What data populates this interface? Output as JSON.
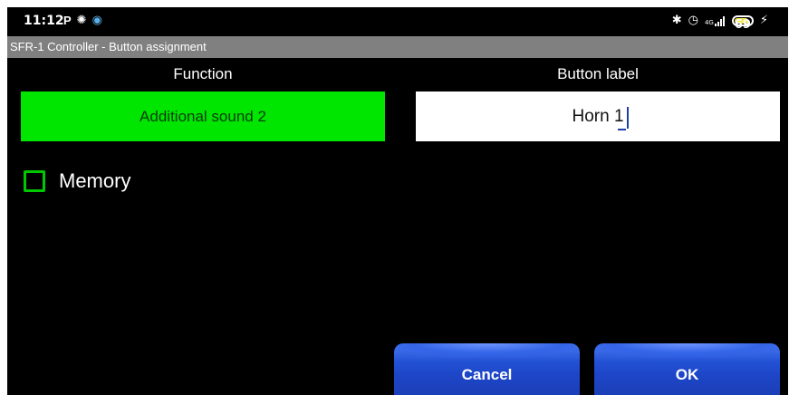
{
  "status_bar": {
    "time": "11:12",
    "left_icons": [
      "parking-icon",
      "settings-gear-icon",
      "app-globe-icon"
    ],
    "right_icons": [
      "bluetooth-icon",
      "alarm-icon",
      "signal-4g-icon",
      "battery-icon",
      "charging-icon"
    ],
    "network_label": "4G",
    "battery_level": "69"
  },
  "title_bar": {
    "title": "SFR-1 Controller - Button assignment"
  },
  "function": {
    "heading": "Function",
    "value": "Additional sound 2",
    "color": "#00e600"
  },
  "button_label": {
    "heading": "Button label",
    "value": "Horn 1"
  },
  "memory": {
    "label": "Memory",
    "checked": false,
    "accent": "#00c800"
  },
  "actions": {
    "cancel_label": "Cancel",
    "ok_label": "OK",
    "button_color": "#2452d6"
  }
}
